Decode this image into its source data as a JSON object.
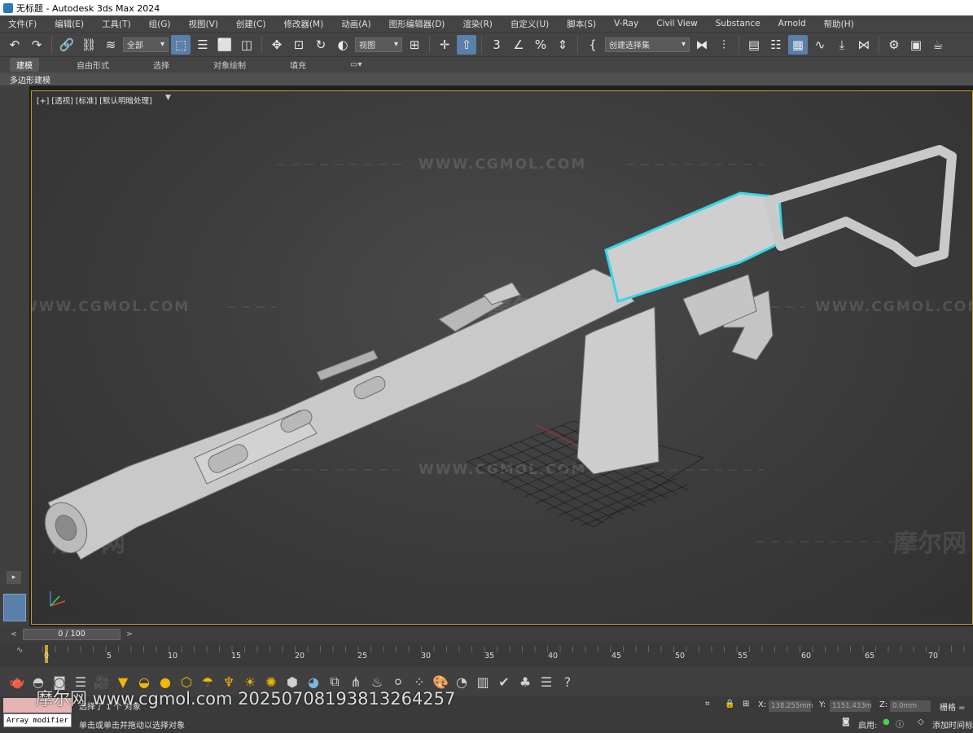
{
  "titlebar": {
    "title": "无标题 - Autodesk 3ds Max 2024"
  },
  "menu": [
    "文件(F)",
    "编辑(E)",
    "工具(T)",
    "组(G)",
    "视图(V)",
    "创建(C)",
    "修改器(M)",
    "动画(A)",
    "图形编辑器(D)",
    "渲染(R)",
    "自定义(U)",
    "脚本(S)",
    "V-Ray",
    "Civil View",
    "Substance",
    "Arnold",
    "帮助(H)"
  ],
  "toolbar": {
    "filter_select": "全部",
    "view_select": "视图",
    "named_selection": "创建选择集"
  },
  "ribbon": {
    "tabs": [
      "建模",
      "自由形式",
      "选择",
      "对象绘制",
      "填充"
    ],
    "active_tab": "建模",
    "sub_label": "多边形建模"
  },
  "viewport": {
    "label": "[+] [透视] [标准] [默认明暗处理]",
    "watermark": "WWW.CGMOL.COM",
    "watermark_cn": "摩尔网",
    "watermark_sub": "WWW.CGMOL.COM"
  },
  "timeslider": {
    "frame_display": "0 / 100"
  },
  "track": {
    "ticks": [
      "0",
      "5",
      "10",
      "15",
      "20",
      "25",
      "30",
      "35",
      "40",
      "45",
      "50",
      "55",
      "60",
      "65",
      "70"
    ]
  },
  "status": {
    "modifier_label": "Array modifier",
    "selection_text": "选择了 1 个 对象",
    "prompt": "单击或单击并拖动以选择对象",
    "x_label": "X:",
    "x_value": "138.255mm",
    "y_label": "Y:",
    "y_value": "1151.433m",
    "z_label": "Z:",
    "z_value": "0.0mm",
    "grid_label": "栅格 =",
    "enable_label": "启用:",
    "add_time_tag": "添加时间标",
    "overlay_watermark": "摩尔网 www.cgmol.com 20250708193813264257"
  },
  "colors": {
    "selection_outline": "#34d6e8",
    "viewport_border": "#c89a3a",
    "active_button": "#5a7fa8"
  }
}
